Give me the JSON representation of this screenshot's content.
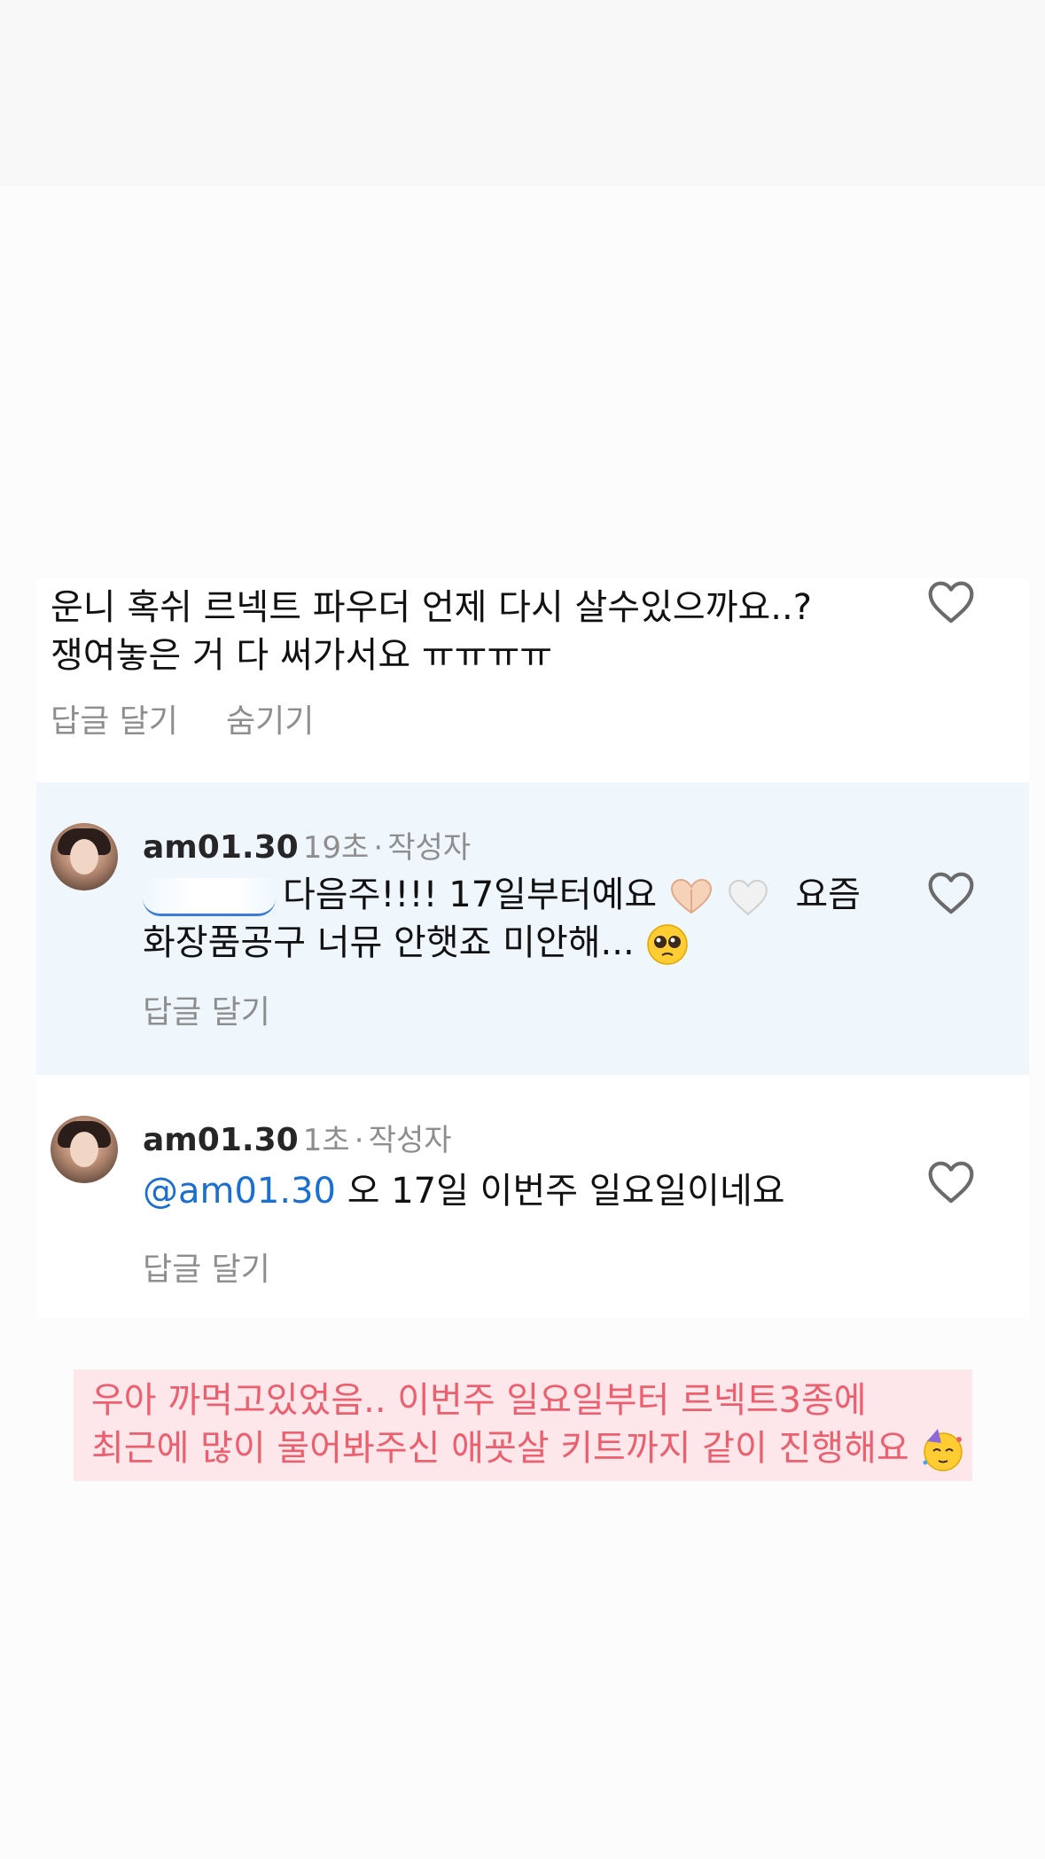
{
  "comments": [
    {
      "text_line1": "운니 혹쉬 르넥트 파우더 언제 다시 살수있으까요..?",
      "text_line2": "쟁여놓은 거 다 써가서요 ㅠㅠㅠㅠ",
      "reply_label": "답글 달기",
      "hide_label": "숨기기"
    },
    {
      "username": "am01.30",
      "time": "19초",
      "separator": "·",
      "author_badge": "작성자",
      "text_line1": "다음주!!!! 17일부터예요",
      "text_line1_tail": "요즘",
      "text_line2": "화장품공구 너뮤 안햇죠 미안해...",
      "reply_label": "답글 달기"
    },
    {
      "username": "am01.30",
      "time": "1초",
      "separator": "·",
      "author_badge": "작성자",
      "mention": "@am01.30",
      "text": "오 17일 이번주 일요일이네요",
      "reply_label": "답글 달기"
    }
  ],
  "caption": {
    "line1": "우아 까먹고있었음.. 이번주 일요일부터 르넥트3종에",
    "line2": "최근에 많이 물어봐주신 애굣살 키트까지 같이 진행해요"
  },
  "colors": {
    "mention": "#1b6fd1",
    "caption_text": "#ec5f6e",
    "caption_bg": "#fde7ea",
    "highlight_bg": "#eff7fd"
  },
  "icons": {
    "like": "heart-outline-icon",
    "emoji_heart_hands": "heart-hands-emoji",
    "emoji_white_heart": "white-heart-emoji",
    "emoji_pleading": "pleading-face-emoji",
    "emoji_party": "partying-face-emoji"
  }
}
